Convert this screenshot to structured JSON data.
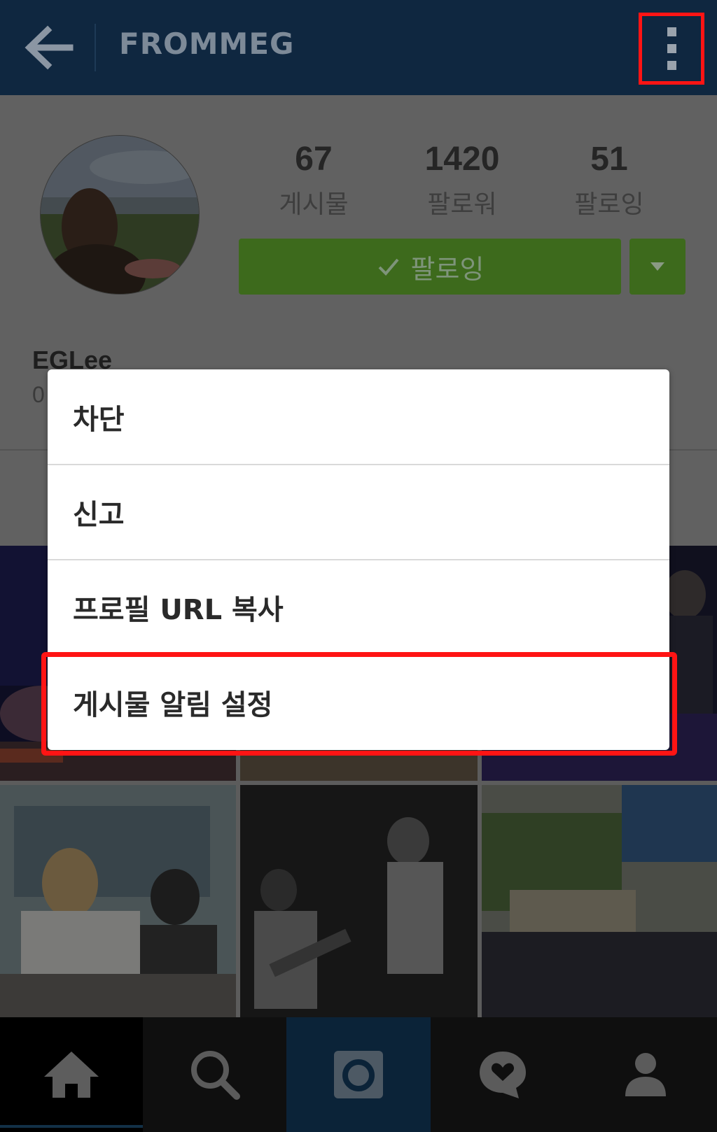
{
  "header": {
    "title": "FROMMEG",
    "back_icon": "back-arrow-icon",
    "more_icon": "more-vertical-icon"
  },
  "profile": {
    "stats": [
      {
        "value": "67",
        "label": "게시물"
      },
      {
        "value": "1420",
        "label": "팔로워"
      },
      {
        "value": "51",
        "label": "팔로잉"
      }
    ],
    "follow_button": "팔로잉",
    "username": "EGLee",
    "bio_visible": "0"
  },
  "menu": {
    "items": [
      "차단",
      "신고",
      "프로필 URL 복사",
      "게시물 알림 설정"
    ]
  },
  "nav": {
    "items": [
      "home-icon",
      "search-icon",
      "camera-icon",
      "heart-bubble-icon",
      "profile-icon"
    ]
  },
  "colors": {
    "topbar": "#0f2740",
    "follow_green": "#3d6a1c",
    "highlight_red": "#ff1414"
  }
}
